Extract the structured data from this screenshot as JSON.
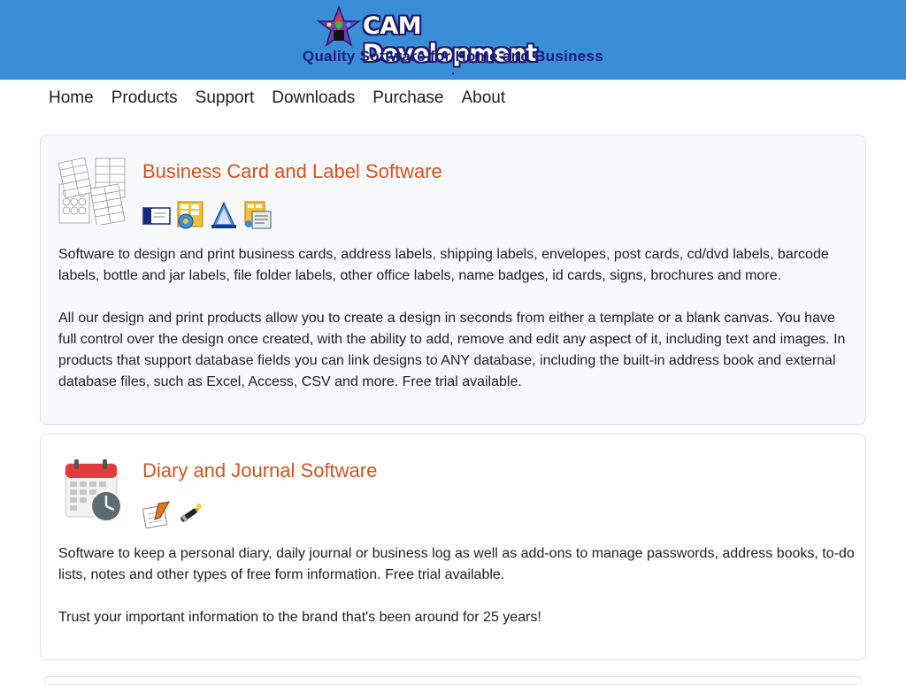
{
  "header": {
    "logo_text": "CAM Development",
    "tagline": "Quality Software for Home and Business",
    "bg_color": "#3a8ed8"
  },
  "nav": {
    "items": [
      {
        "label": "Home"
      },
      {
        "label": "Products"
      },
      {
        "label": "Support"
      },
      {
        "label": "Downloads"
      },
      {
        "label": "Purchase"
      },
      {
        "label": "About"
      }
    ]
  },
  "sections": [
    {
      "title": "Business Card and Label Software",
      "image_icon": "label-sheets-icon",
      "product_icons": [
        "business-card-icon",
        "label-designer-icon",
        "cd-label-icon",
        "office-labels-icon"
      ],
      "paragraphs": [
        "Software to design and print business cards, address labels, shipping labels, envelopes, post cards, cd/dvd labels, barcode labels, bottle and jar labels, file folder labels, other office labels, name badges, id cards, signs, brochures and more.",
        "All our design and print products allow you to create a design in seconds from either a template or a blank canvas. You have full control over the design once created, with the ability to add, remove and edit any aspect of it, including text and images. In products that support database fields you can link designs to ANY database, including the built-in address book and external database files, such as Excel, Access, CSV and more. Free trial available."
      ]
    },
    {
      "title": "Diary and Journal Software",
      "image_icon": "calendar-clock-icon",
      "product_icons": [
        "diary-pad-icon",
        "pen-icon"
      ],
      "paragraphs": [
        "Software to keep a personal diary, daily journal or business log as well as add-ons to manage passwords, address books, to-do lists, notes and other types of free form information. Free trial available.",
        "Trust your important information to the brand that's been around for 25 years!"
      ]
    }
  ],
  "colors": {
    "accent_title": "#d9531e",
    "tagline": "#1a1a7a"
  }
}
